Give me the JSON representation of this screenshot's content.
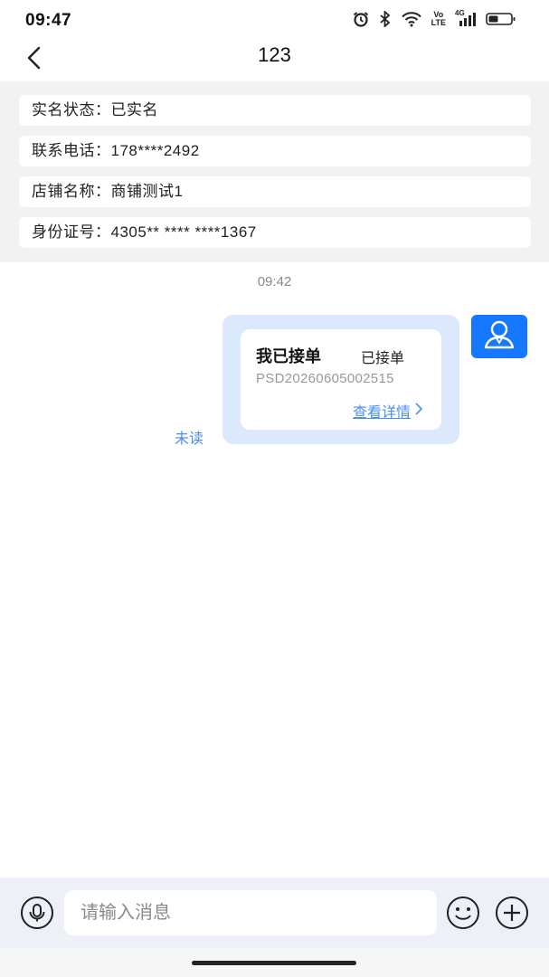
{
  "status_bar": {
    "time": "09:47",
    "icons": [
      "alarm-icon",
      "bluetooth-icon",
      "wifi-icon",
      "volte-icon",
      "signal-4g-icon",
      "battery-icon"
    ],
    "volte_top": "Vo",
    "volte_bottom": "LTE",
    "network": "4G"
  },
  "header": {
    "title": "123",
    "back_icon": "chevron-left-icon"
  },
  "info": {
    "rows": [
      {
        "label": "实名状态：",
        "value": "已实名"
      },
      {
        "label": "联系电话：",
        "value": "178****2492"
      },
      {
        "label": "店铺名称：",
        "value": "商铺测试1"
      },
      {
        "label": "身份证号：",
        "value": "4305** **** ****1367"
      }
    ]
  },
  "chat": {
    "timestamp": "09:42",
    "message": {
      "card_title": "我已接单",
      "card_status": "已接单",
      "order_no": "PSD20260605002515",
      "link_text": "查看详情",
      "read_state": "未读"
    },
    "avatar_icon": "user-avatar-icon"
  },
  "input_bar": {
    "placeholder": "请输入消息",
    "voice_icon": "microphone-icon",
    "emoji_icon": "smiley-icon",
    "plus_icon": "plus-icon"
  },
  "colors": {
    "accent": "#1677ff",
    "bubble": "#dce8fc",
    "link": "#4a8ef0",
    "panel_bg": "#f2f2f3",
    "input_bar_bg": "#eef0f8"
  }
}
